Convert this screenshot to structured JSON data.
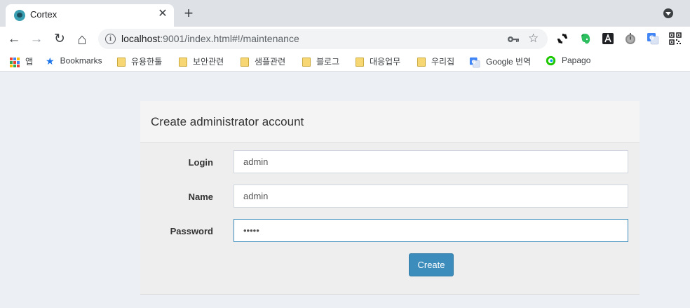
{
  "browser": {
    "tab": {
      "title": "Cortex",
      "close": "✕"
    },
    "new_tab": "+",
    "toolbar": {
      "back": "←",
      "forward": "→",
      "reload": "↻",
      "home": "⌂",
      "url_host": "localhost",
      "url_path": ":9001/index.html#!/maintenance",
      "info": "i",
      "star": "☆"
    },
    "bookmarks": [
      {
        "label": "앱",
        "icon": "apps-grid-icon"
      },
      {
        "label": "Bookmarks",
        "icon": "star-icon"
      },
      {
        "label": "유용한툴",
        "icon": "folder-icon"
      },
      {
        "label": "보안관련",
        "icon": "folder-icon"
      },
      {
        "label": "샘플관련",
        "icon": "folder-icon"
      },
      {
        "label": "블로그",
        "icon": "folder-icon"
      },
      {
        "label": "대응업무",
        "icon": "folder-icon"
      },
      {
        "label": "우리집",
        "icon": "folder-icon"
      },
      {
        "label": "Google 번역",
        "icon": "google-translate-icon"
      },
      {
        "label": "Papago",
        "icon": "papago-icon"
      }
    ]
  },
  "panel": {
    "title": "Create administrator account",
    "fields": {
      "login": {
        "label": "Login",
        "value": "admin"
      },
      "name": {
        "label": "Name",
        "value": "admin"
      },
      "password": {
        "label": "Password",
        "value": "•••••"
      }
    },
    "submit_label": "Create"
  },
  "colors": {
    "page_bg": "#ecf0f5",
    "primary": "#3c8dbc",
    "tab_strip": "#dee1e6"
  }
}
